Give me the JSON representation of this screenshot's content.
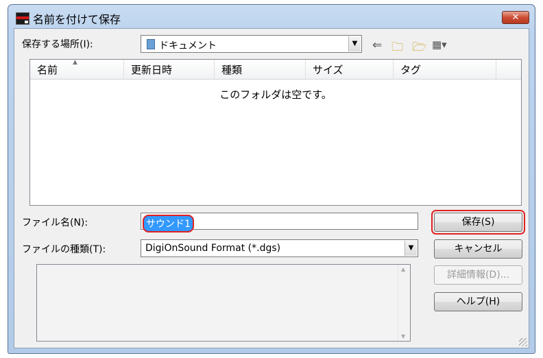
{
  "window": {
    "title": "名前を付けて保存",
    "close_glyph": "✕"
  },
  "location": {
    "label": "保存する場所(I):",
    "value": "ドキュメント",
    "icons": [
      "back-icon",
      "up-folder-icon",
      "new-folder-icon",
      "view-menu-icon"
    ]
  },
  "list": {
    "columns": [
      "名前",
      "更新日時",
      "種類",
      "サイズ",
      "タグ"
    ],
    "empty_message": "このフォルダは空です。"
  },
  "filename": {
    "label": "ファイル名(N):",
    "value": "サウンド1"
  },
  "filetype": {
    "label": "ファイルの種類(T):",
    "value": "DigiOnSound Format (*.dgs)"
  },
  "buttons": {
    "save": "保存(S)",
    "cancel": "キャンセル",
    "details": "詳細情報(D)...",
    "help": "ヘルプ(H)"
  },
  "colors": {
    "highlight": "#e02020",
    "selection": "#3399ff"
  }
}
